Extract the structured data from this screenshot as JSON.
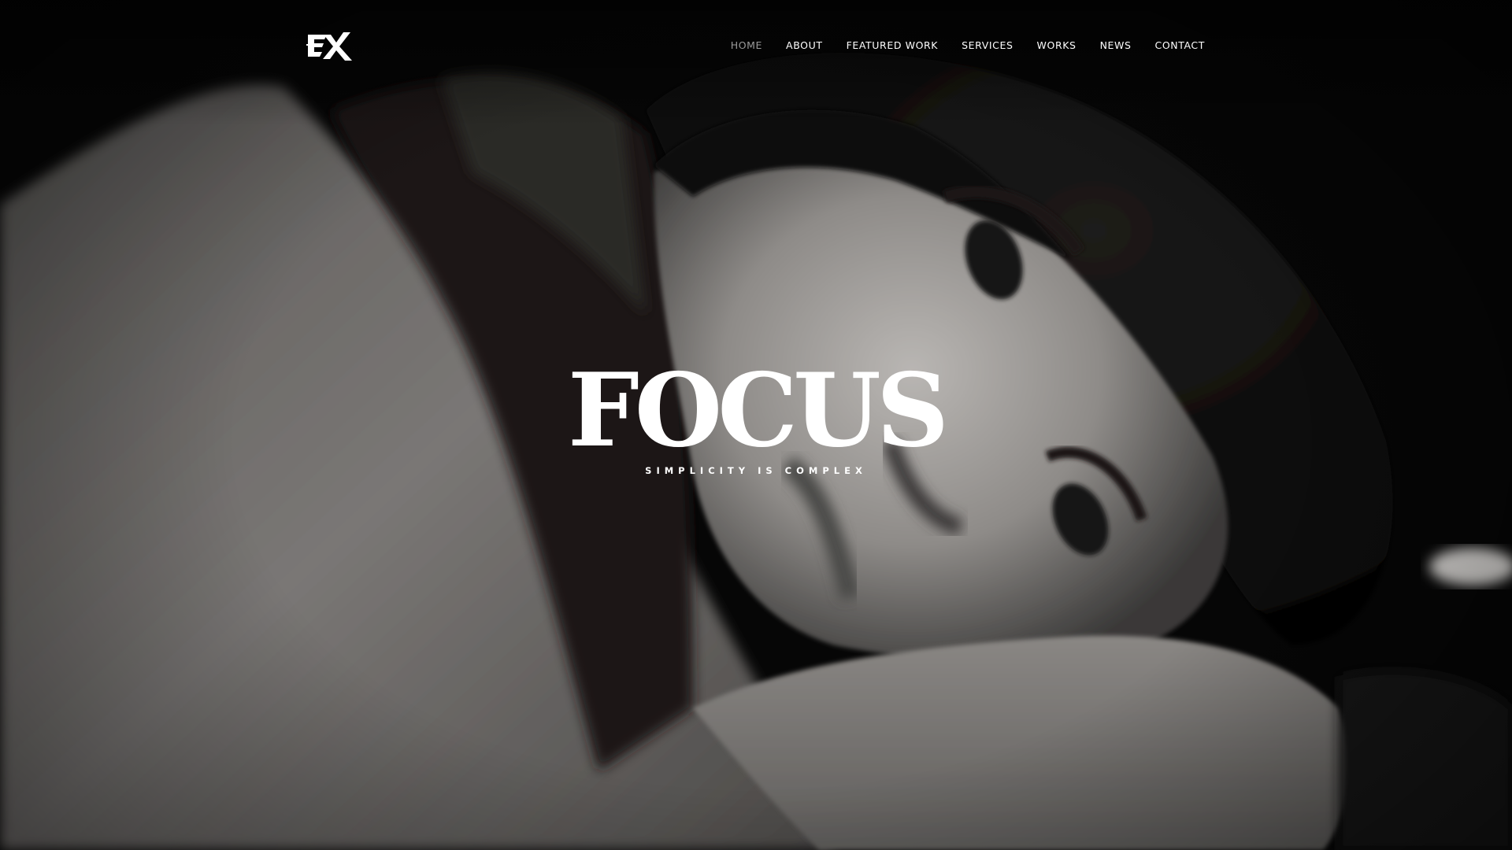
{
  "header": {
    "logo": {
      "text": "EX",
      "icon": "ex-logo-icon"
    },
    "nav": {
      "items": [
        {
          "label": "HOME",
          "active": true
        },
        {
          "label": "ABOUT",
          "active": false
        },
        {
          "label": "FEATURED WORK",
          "active": false
        },
        {
          "label": "SERVICES",
          "active": false
        },
        {
          "label": "WORKS",
          "active": false
        },
        {
          "label": "NEWS",
          "active": false
        },
        {
          "label": "CONTACT",
          "active": false
        }
      ]
    }
  },
  "hero": {
    "title": "FOCUS",
    "subtitle": "SIMPLICITY IS COMPLEX",
    "background": "grayscale portrait photograph"
  },
  "colors": {
    "text": "#ffffff",
    "nav_active": "#9a9a9a",
    "background": "#000000"
  }
}
